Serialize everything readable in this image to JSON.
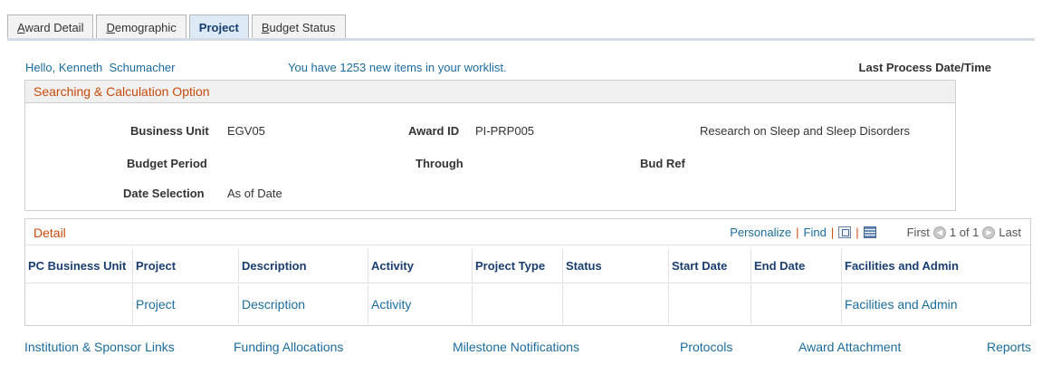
{
  "tabs": [
    {
      "ul": "A",
      "rest": "ward Detail",
      "active": false
    },
    {
      "ul": "D",
      "rest": "emographic",
      "active": false
    },
    {
      "ul": "",
      "rest": "Project",
      "active": true
    },
    {
      "ul": "B",
      "rest": "udget Status",
      "active": false
    }
  ],
  "greeting": "Hello, Kenneth  Schumacher",
  "worklist_msg": "You have 1253 new items in your worklist.",
  "last_process_label": "Last Process Date/Time",
  "search": {
    "title": "Searching & Calculation Option",
    "business_unit_label": "Business Unit",
    "business_unit_value": "EGV05",
    "award_id_label": "Award ID",
    "award_id_value": "PI-PRP005",
    "award_description": "Research on Sleep and Sleep Disorders",
    "budget_period_label": "Budget Period",
    "through_label": "Through",
    "bud_ref_label": "Bud Ref",
    "date_selection_label": "Date Selection",
    "date_selection_value": "As of Date"
  },
  "detail": {
    "title": "Detail",
    "personalize": "Personalize",
    "find": "Find",
    "first": "First",
    "range": "1 of 1",
    "last": "Last",
    "columns": [
      "PC Business Unit",
      "Project",
      "Description",
      "Activity",
      "Project Type",
      "Status",
      "Start Date",
      "End Date",
      "Facilities and Admin"
    ],
    "row": [
      "",
      "Project",
      "Description",
      "Activity",
      "",
      "",
      "",
      "",
      "Facilities and Admin"
    ]
  },
  "bottom_links": [
    "Institution & Sponsor Links",
    "Funding Allocations",
    "Milestone Notifications",
    "Protocols",
    "Award Attachment",
    "Reports"
  ]
}
